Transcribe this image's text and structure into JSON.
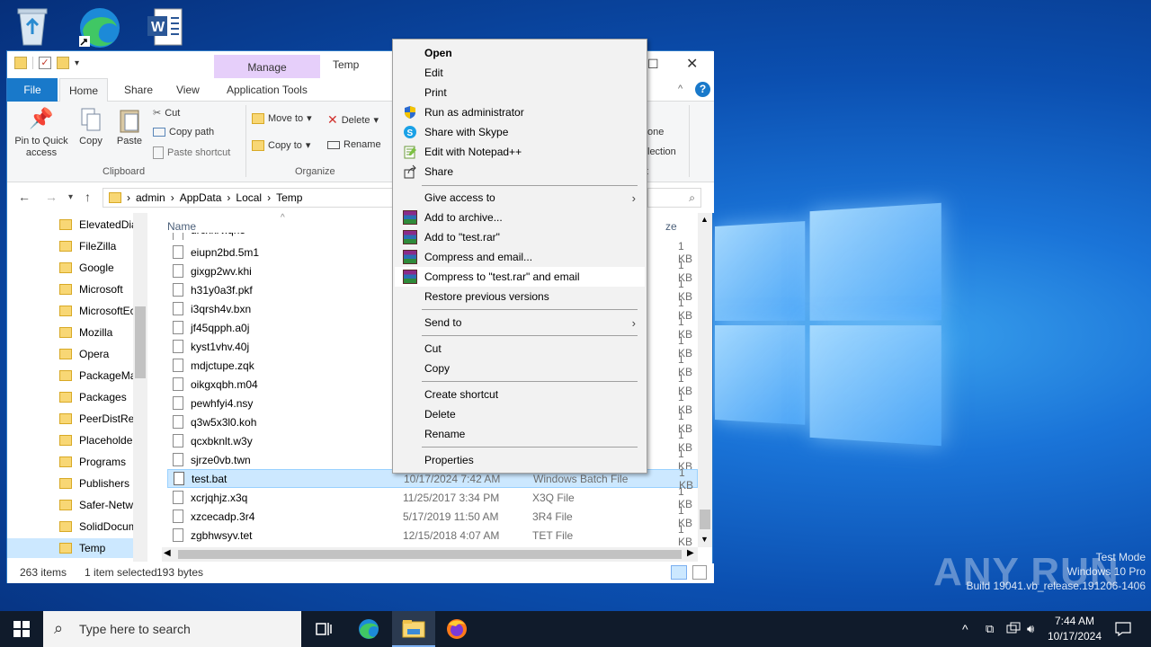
{
  "window": {
    "title": "Temp",
    "manage_tab": "Manage",
    "tabs": [
      "File",
      "Home",
      "Share",
      "View",
      "Application Tools"
    ]
  },
  "ribbon": {
    "pin_quick_access": "Pin to Quick access",
    "copy": "Copy",
    "paste": "Paste",
    "cut": "Cut",
    "copy_path": "Copy path",
    "paste_shortcut": "Paste shortcut",
    "clipboard_label": "Clipboard",
    "move_to": "Move to",
    "copy_to": "Copy to",
    "delete": "Delete",
    "rename": "Rename",
    "organize_label": "Organize",
    "partial_one": "one",
    "partial_lection": "lection",
    "partial_t": "t"
  },
  "address": {
    "crumbs": [
      "admin",
      "AppData",
      "Local",
      "Temp"
    ]
  },
  "nav": {
    "items": [
      "ElevatedDia",
      "FileZilla",
      "Google",
      "Microsoft",
      "MicrosoftEc",
      "Mozilla",
      "Opera",
      "PackageMa",
      "Packages",
      "PeerDistRep",
      "Placeholder",
      "Programs",
      "Publishers",
      "Safer-Netwo",
      "SolidDocum",
      "Temp"
    ]
  },
  "columns": {
    "name": "Name",
    "size": "ze"
  },
  "files": [
    {
      "name": "eiupn2bd.5m1",
      "date": "",
      "type": "",
      "size": "1 KB"
    },
    {
      "name": "gixgp2wv.khi",
      "date": "",
      "type": "",
      "size": "1 KB"
    },
    {
      "name": "h31y0a3f.pkf",
      "date": "",
      "type": "",
      "size": "1 KB"
    },
    {
      "name": "i3qrsh4v.bxn",
      "date": "",
      "type": "",
      "size": "1 KB"
    },
    {
      "name": "jf45qpph.a0j",
      "date": "",
      "type": "",
      "size": "1 KB"
    },
    {
      "name": "kyst1vhv.40j",
      "date": "",
      "type": "",
      "size": "1 KB"
    },
    {
      "name": "mdjctupe.zqk",
      "date": "",
      "type": "",
      "size": "1 KB"
    },
    {
      "name": "oikgxqbh.m04",
      "date": "",
      "type": "",
      "size": "1 KB"
    },
    {
      "name": "pewhfyi4.nsy",
      "date": "",
      "type": "",
      "size": "1 KB"
    },
    {
      "name": "q3w5x3l0.koh",
      "date": "",
      "type": "",
      "size": "1 KB"
    },
    {
      "name": "qcxbknlt.w3y",
      "date": "",
      "type": "",
      "size": "1 KB"
    },
    {
      "name": "sjrze0vb.twn",
      "date": "",
      "type": "",
      "size": "1 KB"
    },
    {
      "name": "test.bat",
      "date": "10/17/2024 7:42 AM",
      "type": "Windows Batch File",
      "size": "1 KB"
    },
    {
      "name": "xcrjqhjz.x3q",
      "date": "11/25/2017 3:34 PM",
      "type": "X3Q File",
      "size": "1 KB"
    },
    {
      "name": "xzcecadp.3r4",
      "date": "5/17/2019 11:50 AM",
      "type": "3R4 File",
      "size": "1 KB"
    },
    {
      "name": "zgbhwsyv.tet",
      "date": "12/15/2018 4:07 AM",
      "type": "TET File",
      "size": "1 KB"
    }
  ],
  "status": {
    "count": "263 items",
    "selected": "1 item selected",
    "size": "193 bytes"
  },
  "context_menu": {
    "open": "Open",
    "edit": "Edit",
    "print": "Print",
    "run_admin": "Run as administrator",
    "share_skype": "Share with Skype",
    "edit_notepad": "Edit with Notepad++",
    "share": "Share",
    "give_access": "Give access to",
    "add_archive": "Add to archive...",
    "add_test_rar": "Add to \"test.rar\"",
    "compress_email": "Compress and email...",
    "compress_test_email": "Compress to \"test.rar\" and email",
    "restore_versions": "Restore previous versions",
    "send_to": "Send to",
    "cut": "Cut",
    "copy": "Copy",
    "create_shortcut": "Create shortcut",
    "delete": "Delete",
    "rename": "Rename",
    "properties": "Properties"
  },
  "taskbar": {
    "search_placeholder": "Type here to search",
    "time": "7:44 AM",
    "date": "10/17/2024"
  },
  "watermark": {
    "brand": "ANY RUN",
    "line1": "Test Mode",
    "line2": "Windows 10 Pro",
    "line3": "Build 19041.vb_release.191206-1406"
  }
}
